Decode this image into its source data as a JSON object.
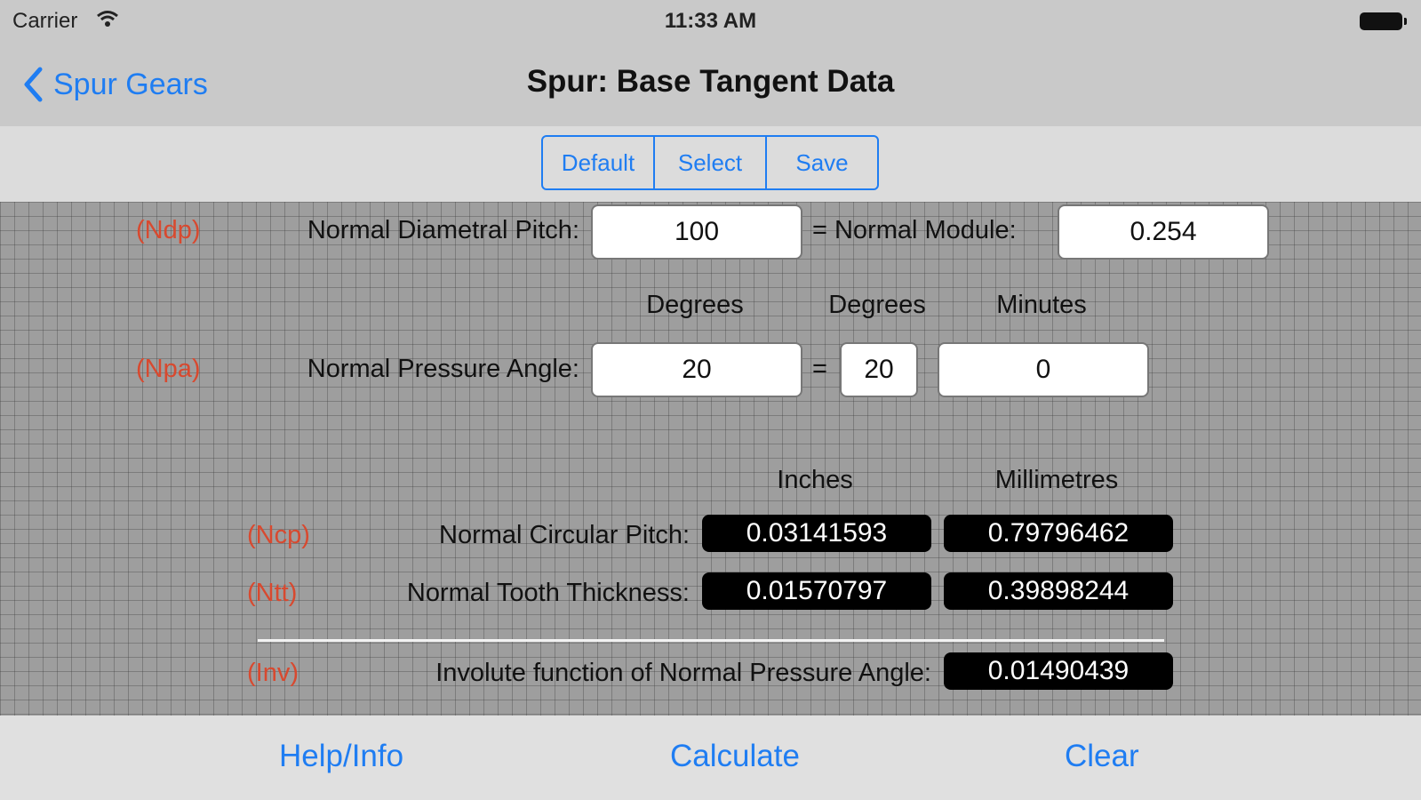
{
  "status": {
    "carrier": "Carrier",
    "time": "11:33 AM"
  },
  "nav": {
    "back_label": "Spur Gears",
    "title": "Spur: Base Tangent Data"
  },
  "segment": {
    "default_label": "Default",
    "select_label": "Select",
    "save_label": "Save"
  },
  "pitch": {
    "code": "(Ndp)",
    "label": "Normal Diametral Pitch:",
    "value": "100",
    "equals_label": "= Normal Module:",
    "module_value": "0.254"
  },
  "angle": {
    "headers": [
      "Degrees",
      "Degrees",
      "Minutes"
    ],
    "code": "(Npa)",
    "label": "Normal Pressure Angle:",
    "degrees_value": "20",
    "equals": "=",
    "deg2_value": "20",
    "minutes_value": "0"
  },
  "results": {
    "headers": [
      "Inches",
      "Millimetres"
    ],
    "circular_pitch": {
      "code": "(Ncp)",
      "label": "Normal Circular Pitch:",
      "inches": "0.03141593",
      "mm": "0.79796462"
    },
    "tooth_thickness": {
      "code": "(Ntt)",
      "label": "Normal Tooth Thickness:",
      "inches": "0.01570797",
      "mm": "0.39898244"
    },
    "involute": {
      "code": "(Inv)",
      "label": "Involute function of Normal Pressure Angle:",
      "value": "0.01490439"
    }
  },
  "bottom": {
    "help_label": "Help/Info",
    "calculate_label": "Calculate",
    "clear_label": "Clear"
  },
  "colors": {
    "accent": "#1f7df2",
    "code_red": "#d8492f",
    "output_bg": "#000000"
  }
}
